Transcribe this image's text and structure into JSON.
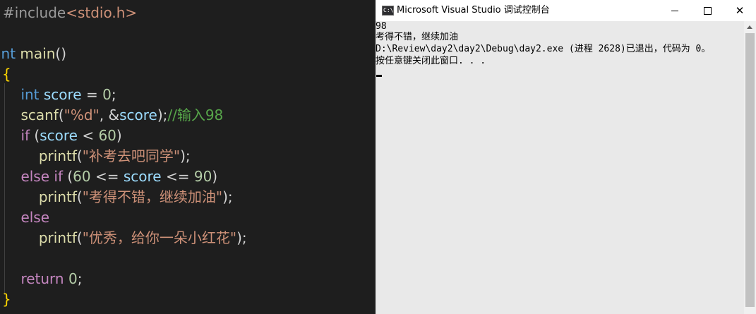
{
  "editor": {
    "lines": [
      [
        {
          "t": "#include",
          "c": "tok-pre"
        },
        {
          "t": "<stdio.h>",
          "c": "tok-inc"
        }
      ],
      [],
      [
        {
          "t": "int",
          "c": "tok-kw"
        },
        {
          "t": " main",
          "c": "tok-fn"
        },
        {
          "t": "()",
          "c": "tok-pun"
        }
      ],
      [
        {
          "t": "{",
          "c": "tok-brace"
        }
      ],
      [
        {
          "t": "    ",
          "c": "tok-pun"
        },
        {
          "t": "int",
          "c": "tok-kw"
        },
        {
          "t": " score",
          "c": "tok-var"
        },
        {
          "t": " = ",
          "c": "tok-pun"
        },
        {
          "t": "0",
          "c": "tok-num"
        },
        {
          "t": ";",
          "c": "tok-pun"
        }
      ],
      [
        {
          "t": "    ",
          "c": "tok-pun"
        },
        {
          "t": "scanf",
          "c": "tok-fn"
        },
        {
          "t": "(",
          "c": "tok-pun"
        },
        {
          "t": "\"%d\"",
          "c": "tok-str"
        },
        {
          "t": ", &",
          "c": "tok-pun"
        },
        {
          "t": "score",
          "c": "tok-var"
        },
        {
          "t": ");",
          "c": "tok-pun"
        },
        {
          "t": "//输入98",
          "c": "tok-cmt"
        }
      ],
      [
        {
          "t": "    ",
          "c": "tok-pun"
        },
        {
          "t": "if",
          "c": "tok-ctl"
        },
        {
          "t": " (",
          "c": "tok-pun"
        },
        {
          "t": "score",
          "c": "tok-var"
        },
        {
          "t": " < ",
          "c": "tok-pun"
        },
        {
          "t": "60",
          "c": "tok-num"
        },
        {
          "t": ")",
          "c": "tok-pun"
        }
      ],
      [
        {
          "t": "        ",
          "c": "tok-pun"
        },
        {
          "t": "printf",
          "c": "tok-fn"
        },
        {
          "t": "(",
          "c": "tok-pun"
        },
        {
          "t": "\"补考去吧同学\"",
          "c": "tok-str"
        },
        {
          "t": ");",
          "c": "tok-pun"
        }
      ],
      [
        {
          "t": "    ",
          "c": "tok-pun"
        },
        {
          "t": "else",
          "c": "tok-ctl"
        },
        {
          "t": " ",
          "c": "tok-pun"
        },
        {
          "t": "if",
          "c": "tok-ctl"
        },
        {
          "t": " (",
          "c": "tok-pun"
        },
        {
          "t": "60",
          "c": "tok-num"
        },
        {
          "t": " <= ",
          "c": "tok-pun"
        },
        {
          "t": "score",
          "c": "tok-var"
        },
        {
          "t": " <= ",
          "c": "tok-pun"
        },
        {
          "t": "90",
          "c": "tok-num"
        },
        {
          "t": ")",
          "c": "tok-pun"
        }
      ],
      [
        {
          "t": "        ",
          "c": "tok-pun"
        },
        {
          "t": "printf",
          "c": "tok-fn"
        },
        {
          "t": "(",
          "c": "tok-pun"
        },
        {
          "t": "\"考得不错，继续加油\"",
          "c": "tok-str"
        },
        {
          "t": ");",
          "c": "tok-pun"
        }
      ],
      [
        {
          "t": "    ",
          "c": "tok-pun"
        },
        {
          "t": "else",
          "c": "tok-ctl"
        }
      ],
      [
        {
          "t": "        ",
          "c": "tok-pun"
        },
        {
          "t": "printf",
          "c": "tok-fn"
        },
        {
          "t": "(",
          "c": "tok-pun"
        },
        {
          "t": "\"优秀，给你一朵小红花\"",
          "c": "tok-str"
        },
        {
          "t": ");",
          "c": "tok-pun"
        }
      ],
      [],
      [
        {
          "t": "    ",
          "c": "tok-pun"
        },
        {
          "t": "return",
          "c": "tok-ctl"
        },
        {
          "t": " ",
          "c": "tok-pun"
        },
        {
          "t": "0",
          "c": "tok-num"
        },
        {
          "t": ";",
          "c": "tok-pun"
        }
      ],
      [
        {
          "t": "}",
          "c": "tok-brace"
        }
      ]
    ]
  },
  "console": {
    "title": "Microsoft Visual Studio 调试控制台",
    "icon": "console-app-icon",
    "icon_label": "C:\\",
    "output": [
      "98",
      "考得不错，继续加油",
      "D:\\Review\\day2\\day2\\Debug\\day2.exe (进程 2628)已退出，代码为 0。",
      "按任意键关闭此窗口. . ."
    ],
    "close_symbol": "✕"
  }
}
